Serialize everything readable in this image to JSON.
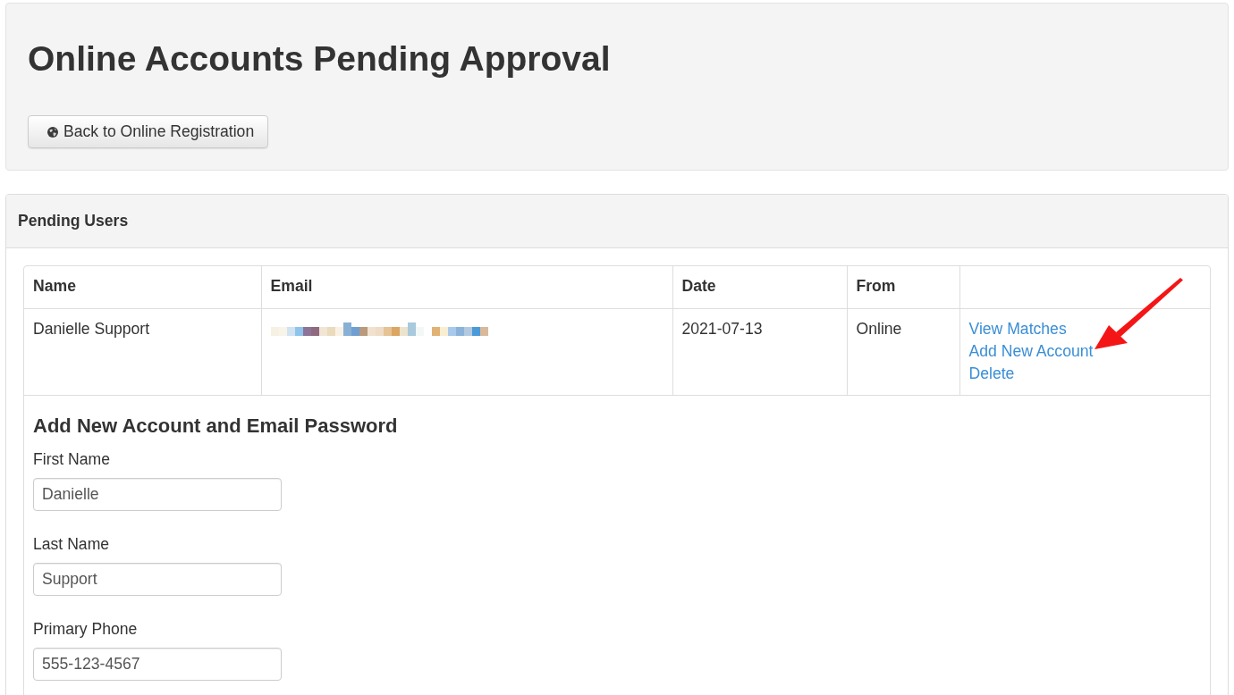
{
  "header": {
    "title": "Online Accounts Pending Approval",
    "back_button": {
      "label": "Back to Online Registration"
    }
  },
  "pending_users": {
    "title": "Pending Users",
    "table": {
      "columns": [
        {
          "label": "Name"
        },
        {
          "label": "Email"
        },
        {
          "label": "Date"
        },
        {
          "label": "From"
        }
      ],
      "rows": [
        {
          "cells": [
            {
              "kind": "text",
              "text": "Danielle Support"
            },
            {
              "kind": "pixelated"
            },
            {
              "kind": "text",
              "text": "2021-07-13"
            },
            {
              "kind": "text",
              "text": "Online"
            },
            {
              "kind": "links",
              "links": [
                {
                  "label": "View Matches",
                  "annotated": false
                },
                {
                  "label": "Add New Account",
                  "annotated": true
                },
                {
                  "label": "Delete",
                  "annotated": false
                }
              ]
            }
          ]
        }
      ]
    },
    "form": {
      "title": "Add New Account and Email Password",
      "fields": [
        {
          "label": "First Name",
          "value": "Danielle"
        },
        {
          "label": "Last Name",
          "value": "Support"
        },
        {
          "label": "Primary Phone",
          "value": "555-123-4567"
        }
      ]
    }
  }
}
